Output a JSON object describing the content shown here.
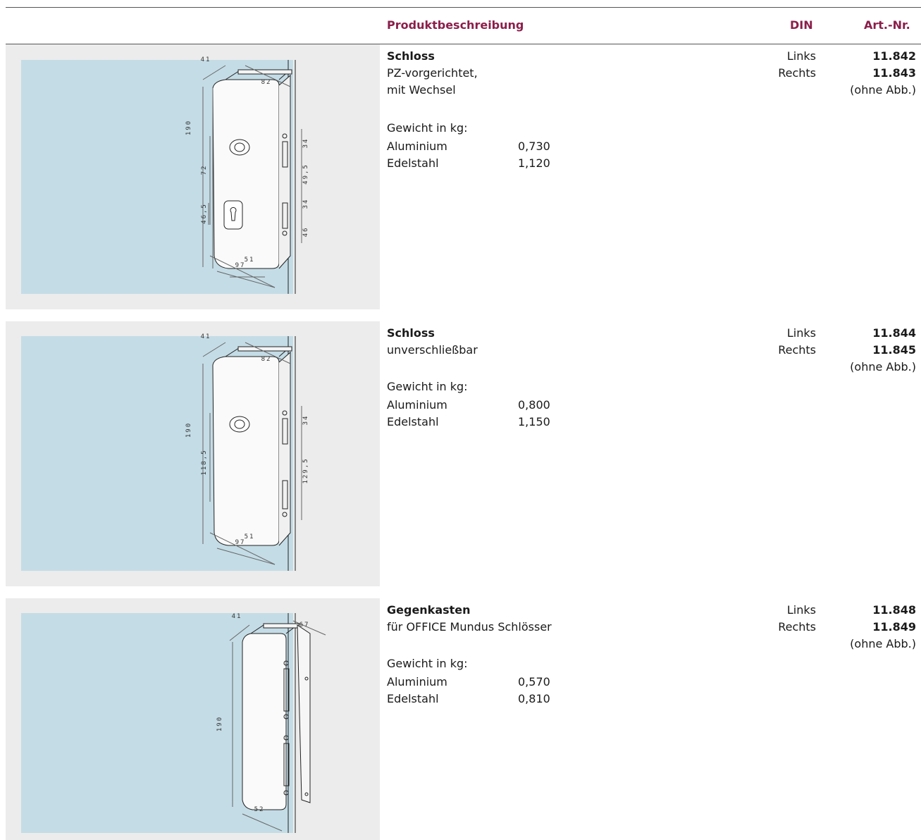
{
  "header": {
    "col_description": "Produktbeschreibung",
    "col_din": "DIN",
    "col_art": "Art.-Nr."
  },
  "colors": {
    "accent": "#8b1e4b",
    "panel_bg": "#ececec",
    "glass": "#c4dce6"
  },
  "products": [
    {
      "title": "Schloss",
      "desc_lines": [
        "PZ-vorgerichtet,",
        "mit Wechsel"
      ],
      "weight_label": "Gewicht in kg:",
      "weights": [
        {
          "material": "Aluminium",
          "value": "0,730"
        },
        {
          "material": "Edelstahl",
          "value": "1,120"
        }
      ],
      "din": [
        "Links",
        "Rechts"
      ],
      "art": [
        "11.842",
        "11.843"
      ],
      "note": "(ohne Abb.)",
      "dims": {
        "depth": "41",
        "width_top": "82",
        "height": "190",
        "mid": "72",
        "bottom": "46,5",
        "front": "51",
        "base": "97",
        "r1": "34",
        "r2": "49,5",
        "r3": "34",
        "r4": "46"
      }
    },
    {
      "title": "Schloss",
      "desc_lines": [
        "unverschließbar"
      ],
      "weight_label": "Gewicht in kg:",
      "weights": [
        {
          "material": "Aluminium",
          "value": "0,800"
        },
        {
          "material": "Edelstahl",
          "value": "1,150"
        }
      ],
      "din": [
        "Links",
        "Rechts"
      ],
      "art": [
        "11.844",
        "11.845"
      ],
      "note": "(ohne Abb.)",
      "dims": {
        "depth": "41",
        "width_top": "82",
        "height": "190",
        "mid": "118,5",
        "front": "51",
        "base": "97",
        "r1": "34",
        "r2": "129,5"
      }
    },
    {
      "title": "Gegenkasten",
      "desc_lines": [
        "für OFFICE Mundus Schlösser"
      ],
      "weight_label": "Gewicht in kg:",
      "weights": [
        {
          "material": "Aluminium",
          "value": "0,570"
        },
        {
          "material": "Edelstahl",
          "value": "0,810"
        }
      ],
      "din": [
        "Links",
        "Rechts"
      ],
      "art": [
        "11.848",
        "11.849"
      ],
      "note": "(ohne Abb.)",
      "dims": {
        "depth": "41",
        "width_top": "67",
        "height": "190",
        "base": "52"
      }
    }
  ]
}
